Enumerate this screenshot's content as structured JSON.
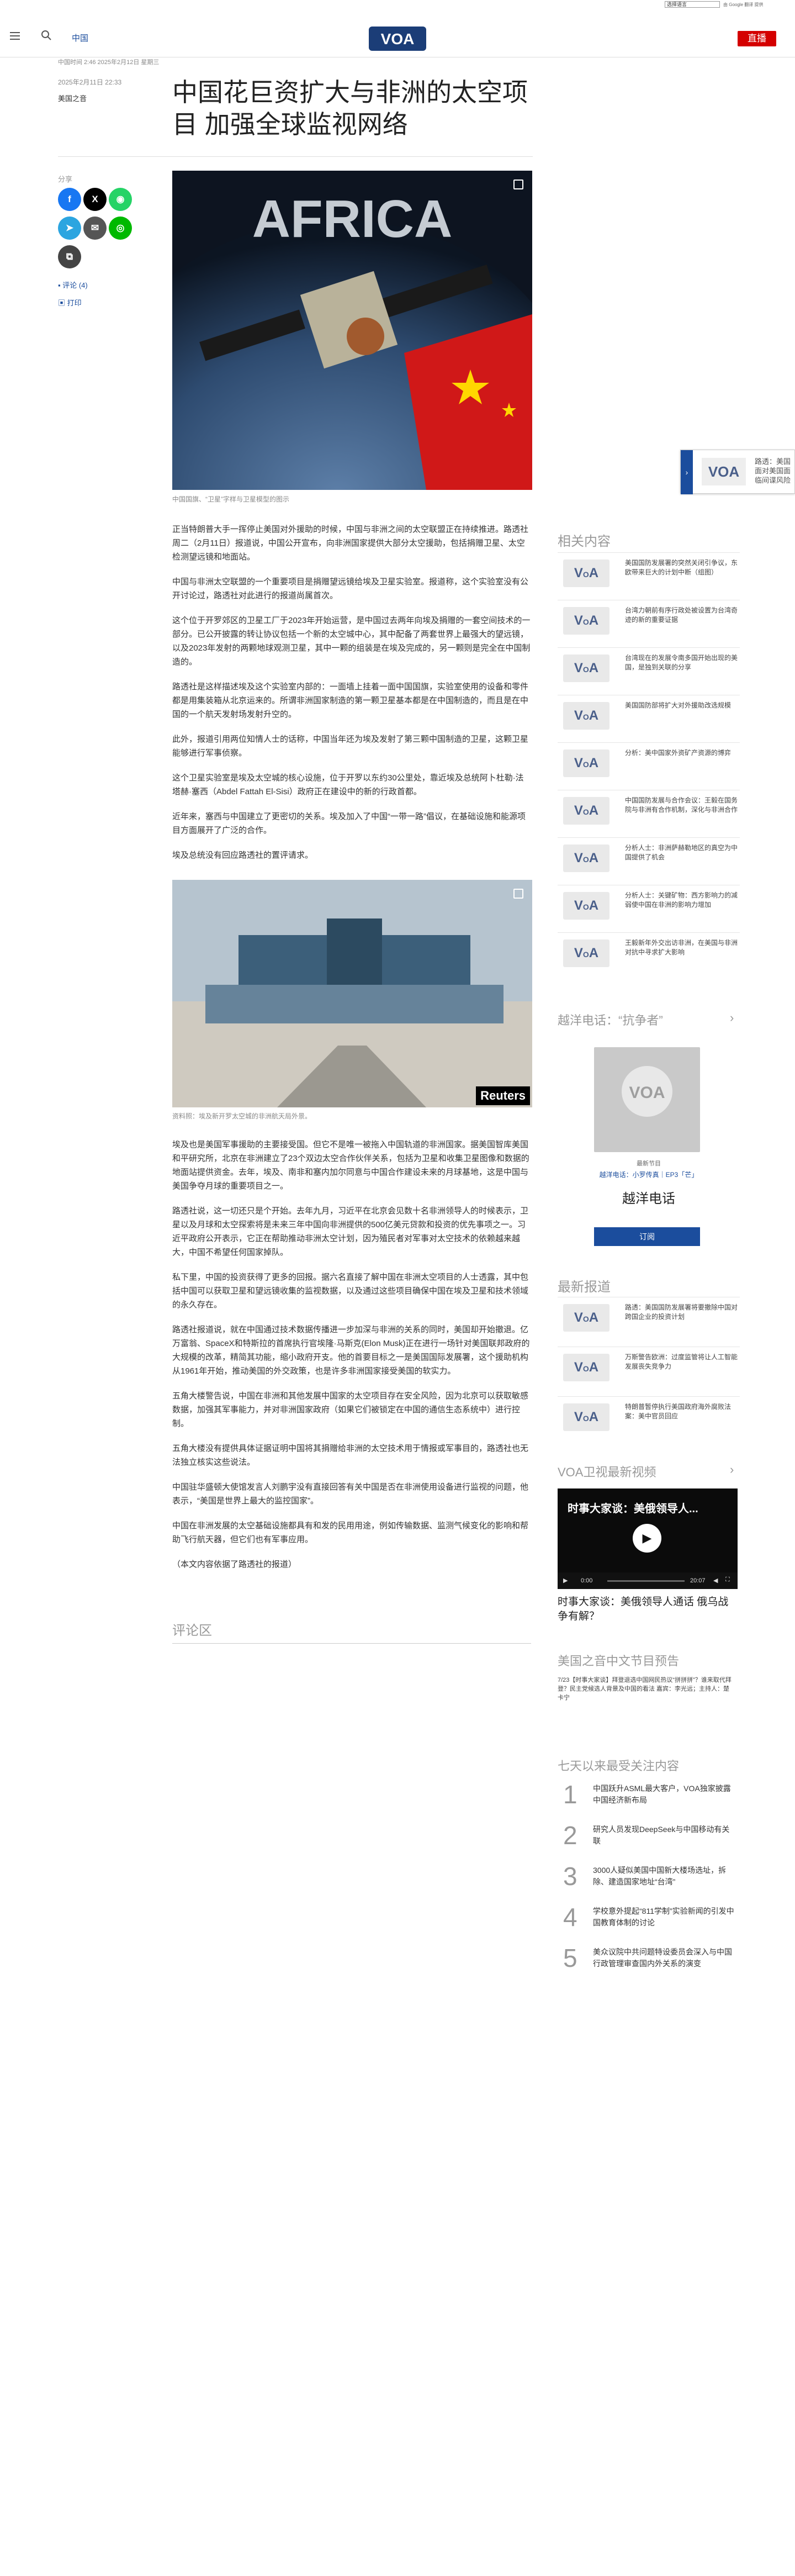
{
  "topbar": {
    "lang_select": "选择语言",
    "google_credit": "由 Google 翻译 提供"
  },
  "header": {
    "section": "中国",
    "logo": "VOA",
    "live_label": "直播"
  },
  "article": {
    "meta_date": "中国时间 2:46 2025年2月12日 星期三",
    "pub_date": "2025年2月11日 22:33",
    "author": "美国之音",
    "title": "中国花巨资扩大与非洲的太空项目 加强全球监视网络",
    "share_label": "分享",
    "comments_link": "评论 (4)",
    "print_link": "打印",
    "image_caption": "中国国旗、“卫星”字样与卫星模型的图示",
    "paragraphs": [
      "正当特朗普大手一挥停止美国对外援助的时候，中国与非洲之间的太空联盟正在持续推进。路透社周二（2月11日）报道说，中国公开宣布，向非洲国家提供大部分太空援助，包括捐赠卫星、太空检测望远镜和地面站。",
      "中国与非洲太空联盟的一个重要项目是捐赠望远镜给埃及卫星实验室。报道称，这个实验室没有公开讨论过，路透社对此进行的报道尚属首次。",
      "这个位于开罗郊区的卫星工厂于2023年开始运营，是中国过去两年向埃及捐赠的一套空间技术的一部分。已公开披露的转让协议包括一个新的太空城中心，其中配备了两套世界上最强大的望远镜，以及2023年发射的两颗地球观测卫星，其中一颗的组装是在埃及完成的，另一颗则是完全在中国制造的。",
      "路透社是这样描述埃及这个实验室内部的：一面墙上挂着一面中国国旗，实验室使用的设备和零件都是用集装箱从北京运来的。所谓非洲国家制造的第一颗卫星基本都是在中国制造的，而且是在中国的一个航天发射场发射升空的。",
      "此外，报道引用两位知情人士的话称，中国当年还为埃及发射了第三颗中国制造的卫星，这颗卫星能够进行军事侦察。",
      "这个卫星实验室是埃及太空城的核心设施，位于开罗以东约30公里处，靠近埃及总统阿卜杜勒·法塔赫·塞西（Abdel Fattah El-Sisi）政府正在建设中的新的行政首都。",
      "近年来，塞西与中国建立了更密切的关系。埃及加入了中国“一带一路”倡议，在基础设施和能源项目方面展开了广泛的合作。",
      "埃及总统没有回应路透社的置评请求。"
    ],
    "image2_caption": "资料照：埃及新开罗太空城的非洲航天局外景。",
    "image2_watermark": "Reuters",
    "paragraphs2": [
      "埃及也是美国军事援助的主要接受国。但它不是唯一被拖入中国轨道的非洲国家。据美国智库美国和平研究所，北京在非洲建立了23个双边太空合作伙伴关系，包括为卫星和收集卫星图像和数据的地面站提供资金。去年，埃及、南非和塞内加尔同意与中国合作建设未来的月球基地，这是中国与美国争夺月球的重要项目之一。",
      "路透社说，这一切还只是个开始。去年九月，习近平在北京会见数十名非洲领导人的时候表示，卫星以及月球和太空探索将是未来三年中国向非洲提供的500亿美元贷款和投资的优先事项之一。习近平政府公开表示，它正在帮助推动非洲太空计划，因为殖民者对军事对太空技术的依赖越来越大，中国不希望任何国家掉队。",
      "私下里，中国的投资获得了更多的回报。据六名直接了解中国在非洲太空项目的人士透露，其中包括中国可以获取卫星和望远镜收集的监视数据，以及通过这些项目确保中国在埃及卫星和技术领域的永久存在。",
      "路透社报道说，就在中国通过技术数据传播进一步加深与非洲的关系的同时，美国却开始撤退。亿万富翁、SpaceX和特斯拉的首席执行官埃隆·马斯克(Elon Musk)正在进行一场针对美国联邦政府的大规模的改革，精简其功能，缩小政府开支。他的首要目标之一是美国国际发展署，这个援助机构从1961年开始，推动美国的外交政策，也是许多非洲国家接受美国的软实力。",
      "五角大楼警告说，中国在非洲和其他发展中国家的太空项目存在安全风险，因为北京可以获取敏感数据，加强其军事能力，并对非洲国家政府（如果它们被锁定在中国的通信生态系统中）进行控制。",
      "五角大楼没有提供具体证据证明中国将其捐赠给非洲的太空技术用于情报或军事目的，路透社也无法独立核实这些说法。",
      "中国驻华盛顿大使馆发言人刘鹏宇没有直接回答有关中国是否在非洲使用设备进行监视的问题，他表示，“美国是世界上最大的监控国家”。",
      "中国在非洲发展的太空基础设施都具有和发的民用用途，例如传输数据、监测气候变化的影响和帮助飞行航天器，但它们也有军事应用。",
      "（本文内容依据了路透社的报道）"
    ],
    "comments_heading": "评论区"
  },
  "floating_card": {
    "logo": "VOA",
    "text": "路透：美国面对美国面临间谍风险"
  },
  "rail": {
    "related_title": "相关内容",
    "related": [
      "美国国防发展署的突然关闭引争议，东欧带来巨大的计划中断（组图）",
      "台湾力朝前有序行政处被设置为台湾奇迹的新的重要证据",
      "台湾现在的发展令南多国开始出现的美国，是独到关联的分享",
      "美国国防部将扩大对外援助改选规模",
      "分析：美中国家外资矿产资源的博弈",
      "中国国防发展与合作会议：王毅在国务院与非洲有合作机制，深化与非洲合作",
      "分析人士：非洲萨赫勒地区的真空为中国提供了机会",
      "分析人士：关键矿物：西方影响力的减弱使中国在非洲的影响力增加",
      "王毅新年外交出访非洲，在美国与非洲对抗中寻求扩大影响"
    ],
    "podcast_title": "越洋电话：“抗争者”",
    "podcast_label": "最新节目",
    "podcast_sub": "越洋电话：小罗传真｜EP3「芒」",
    "podcast_name": "越洋电话",
    "podcast_btn": "订阅",
    "latest_title": "最新报道",
    "latest": [
      "路透：美国国防发展署将要撤除中国对跨国企业的投资计划",
      "万斯警告欧洲：过度监管将让人工智能发展丧失竞争力",
      "特朗普暂停执行美国政府海外腐败法案：美中官员回应"
    ],
    "video_title": "VOA卫视最新视频",
    "video_overlay": "时事大家谈：美俄领导人...",
    "video_time": "0:00",
    "video_end": "20:07",
    "video_caption": "时事大家谈：美俄领导人通话 俄乌战争有解？",
    "schedule_title": "美国之音中文节目预告",
    "schedule_text": "7/23【时事大家谈】拜登退选中国网民热议“拼拼拼”？谁来取代拜登？民主党候选人背景及中国的看法 嘉宾：李光远；主持人：楚卡宁",
    "mostread_title": "七天以来最受关注内容",
    "mostread": [
      "中国跃升ASML最大客户，VOA独家披露中国经济新布局",
      "研究人员发现DeepSeek与中国移动有关联",
      "3000人疑似美国中国新大楼场选址，拆除、建造国家地址“台湾”",
      "学校意外提起“811学制”实验新闻的引发中国教育体制的讨论",
      "美众议院中共问题特设委员会深入与中国行政管理审查国内外关系的演变"
    ]
  }
}
